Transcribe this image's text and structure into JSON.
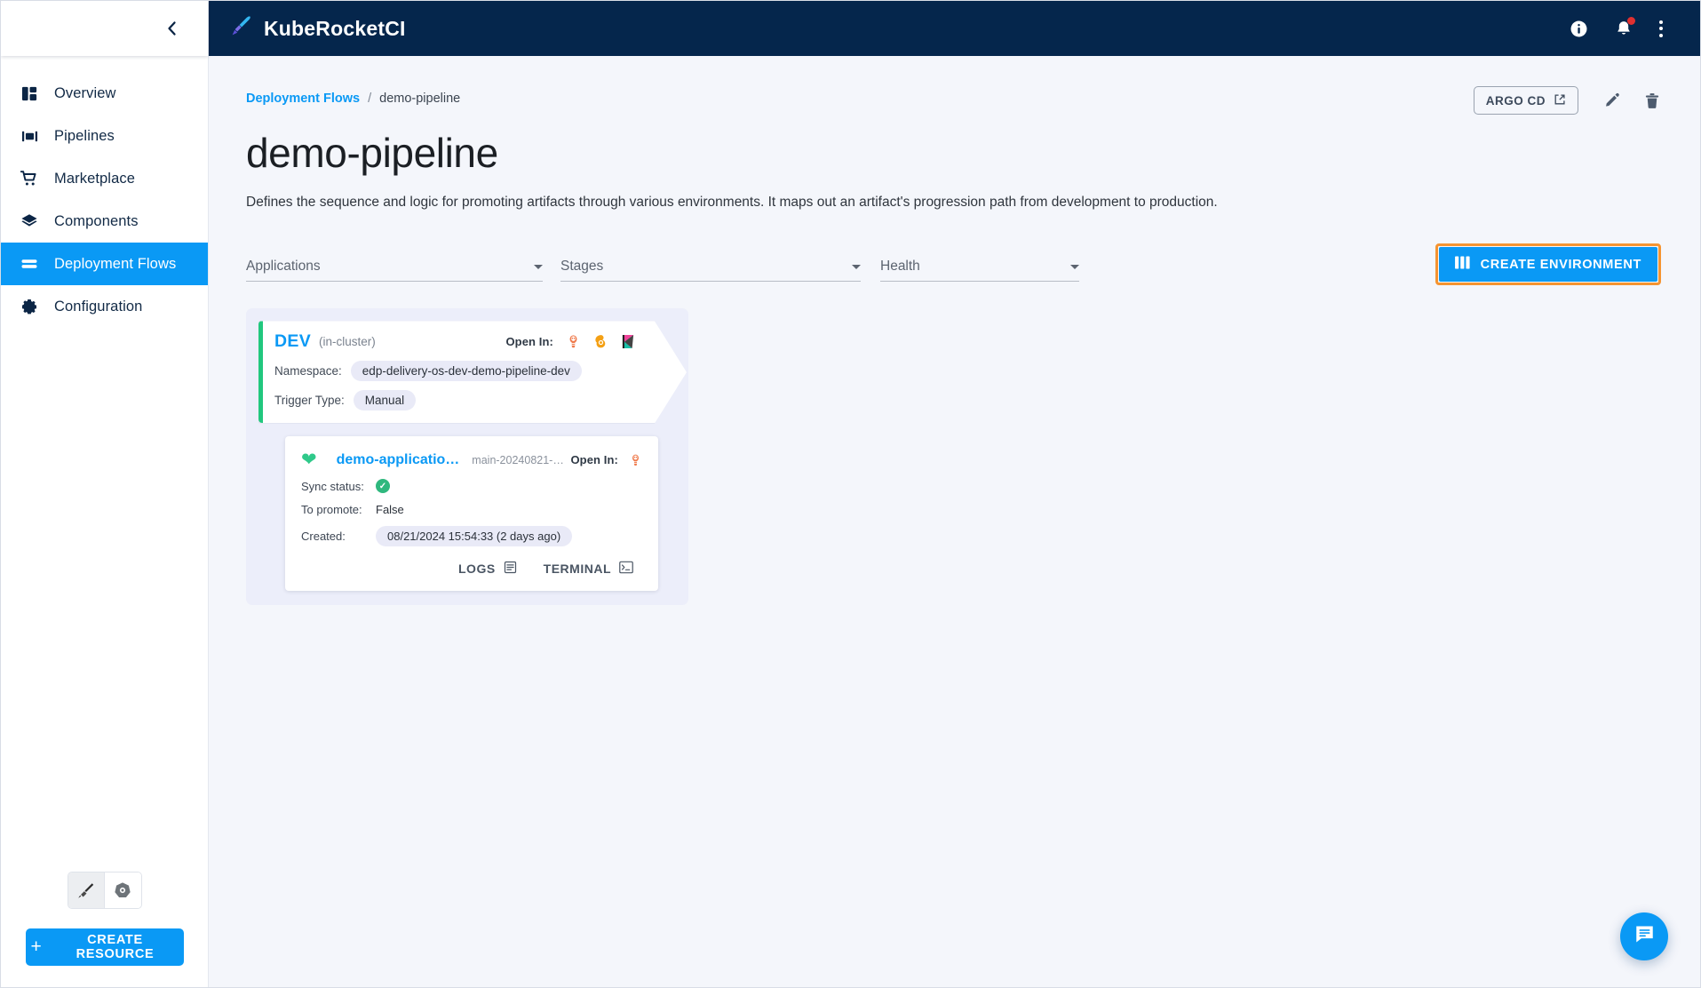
{
  "topbar": {
    "brand": "KubeRocketCI",
    "logo_icon": "rocket-pen-icon",
    "info_icon": "info-circle-icon",
    "notifications_icon": "bell-icon",
    "menu_icon": "kebab-menu-icon",
    "background": "#05264c"
  },
  "sidebar": {
    "collapse_icon": "chevron-left-icon",
    "items": [
      {
        "label": "Overview",
        "icon": "dashboard-icon",
        "active": false
      },
      {
        "label": "Pipelines",
        "icon": "pipelines-icon",
        "active": false
      },
      {
        "label": "Marketplace",
        "icon": "cart-icon",
        "active": false
      },
      {
        "label": "Components",
        "icon": "layers-icon",
        "active": false
      },
      {
        "label": "Deployment Flows",
        "icon": "flows-icon",
        "active": true
      },
      {
        "label": "Configuration",
        "icon": "gear-icon",
        "active": false
      }
    ],
    "cluster_switch": [
      {
        "icon": "krci-sword-icon",
        "selected": true
      },
      {
        "icon": "kubernetes-icon",
        "selected": false
      }
    ],
    "create_resource_label": "CREATE RESOURCE",
    "create_resource_plus": "+",
    "active_color": "#0a99f5"
  },
  "page": {
    "breadcrumb": {
      "parent": "Deployment Flows",
      "separator": "/",
      "current": "demo-pipeline"
    },
    "title": "demo-pipeline",
    "description": "Defines the sequence and logic for promoting artifacts through various environments. It maps out an artifact's progression path from development to production.",
    "actions": {
      "argo_cd_label": "ARGO CD",
      "argo_cd_icon": "external-link-icon",
      "edit_icon": "pencil-icon",
      "delete_icon": "trash-icon"
    }
  },
  "filters": [
    {
      "label": "Applications",
      "name": "applications"
    },
    {
      "label": "Stages",
      "name": "stages"
    },
    {
      "label": "Health",
      "name": "health"
    }
  ],
  "create_environment": {
    "label": "CREATE ENVIRONMENT",
    "icon": "columns-icon",
    "highlight_color": "#f59431",
    "background": "#0a99f5"
  },
  "stage": {
    "name": "DEV",
    "subtitle": "(in-cluster)",
    "accent_color": "#21c77e",
    "open_in_label": "Open In:",
    "open_in_icons": [
      "argocd-icon",
      "grafana-icon",
      "kibana-icon"
    ],
    "fields": [
      {
        "key": "Namespace:",
        "value": "edp-delivery-os-dev-demo-pipeline-dev"
      },
      {
        "key": "Trigger Type:",
        "value": "Manual"
      }
    ]
  },
  "application": {
    "health_icon": "heart-icon",
    "health_color": "#2fc98a",
    "name": "demo-applicatio…",
    "branch": "main-20240821-…",
    "open_in_label": "Open In:",
    "open_in_icons": [
      "argocd-icon"
    ],
    "fields": [
      {
        "key": "Sync status:",
        "value": "",
        "badge": "synced-check-icon"
      },
      {
        "key": "To promote:",
        "value": "False"
      },
      {
        "key": "Created:",
        "value": "08/21/2024 15:54:33 (2 days ago)"
      }
    ],
    "actions": [
      {
        "label": "LOGS",
        "icon": "logs-icon"
      },
      {
        "label": "TERMINAL",
        "icon": "terminal-icon"
      }
    ]
  },
  "fab": {
    "icon": "chat-icon",
    "color": "#0a99f5"
  }
}
